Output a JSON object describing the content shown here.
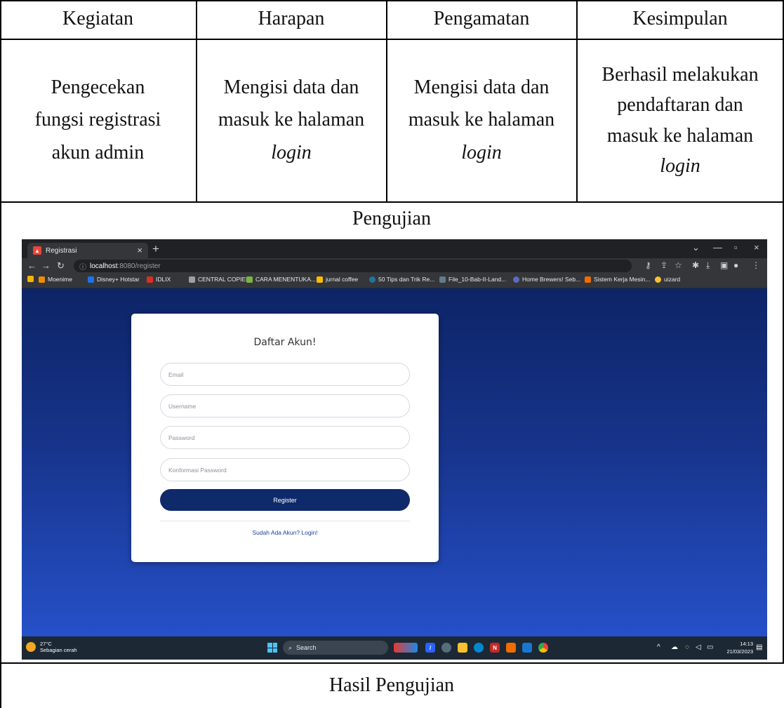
{
  "table": {
    "headers": [
      "Kegiatan",
      "Harapan",
      "Pengamatan",
      "Kesimpulan"
    ],
    "row": {
      "kegiatan": [
        "Pengecekan",
        "fungsi registrasi",
        "akun admin"
      ],
      "harapan": [
        "Mengisi data dan",
        "masuk ke halaman",
        "login"
      ],
      "pengamatan": [
        "Mengisi data dan",
        "masuk ke halaman",
        "login"
      ],
      "kesimpulan": [
        "Berhasil melakukan",
        "pendaftaran dan",
        "masuk ke halaman",
        "login"
      ]
    },
    "pengujian_label": "Pengujian",
    "hasil_label": "Hasil Pengujian"
  },
  "browser": {
    "tab_title": "Registrasi",
    "url_host": "localhost",
    "url_path": ":8080/register",
    "bookmarks": [
      "Moenime",
      "Disney+ Hotstar",
      "IDLIX",
      "CENTRAL COPIER",
      "CARA MENENTUKA...",
      "jurnal coffee",
      "50 Tips dan Trik Re...",
      "File_10-Bab-II-Land...",
      "Home Brewers! Seb...",
      "Sistem Kerja Mesin...",
      "uizard"
    ]
  },
  "form": {
    "title": "Daftar Akun!",
    "email_placeholder": "Email",
    "username_placeholder": "Username",
    "password_placeholder": "Password",
    "confirm_placeholder": "Konformasi Password",
    "register_label": "Register",
    "login_link": "Sudah Ada Akun? Login!"
  },
  "taskbar": {
    "temperature": "27°C",
    "weather": "Sebagian cerah",
    "search_label": "Search",
    "time": "14:13",
    "date": "21/03/2023"
  }
}
